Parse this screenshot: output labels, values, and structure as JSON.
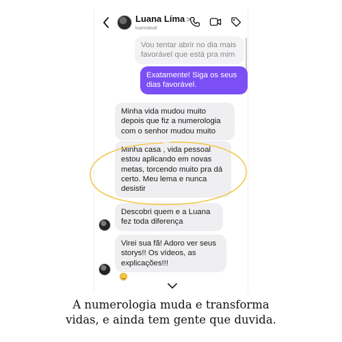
{
  "header": {
    "contact_name": "Luana Líma",
    "chevron": ">",
    "username": "luannawal",
    "icons": [
      "back-icon",
      "phone-icon",
      "video-icon",
      "tag-icon"
    ]
  },
  "messages": {
    "m1": "Vou tentar abrir no dia mais favorável que está pra mim",
    "m2": "Exatamente! Siga os seus dias favorável.",
    "m3": "Minha vida mudou muito depois que fiz a numerologia com o senhor mudou muito",
    "m4": "Minha casa , vida pessoal estou aplicando em novas metas, torcendo muito pra dá certo. Meu lema e nunca desistir",
    "m5": "Descobri quem e a Luana fez toda diferença",
    "m6": "Virei sua fã! Adoro ver seus storys!! Os vídeos, as explicações!!!"
  },
  "reaction_emoji": "smile-emoji",
  "caption": {
    "line1": "A numerologia muda e transforma",
    "line2": "vidas, e ainda tem gente que duvida."
  },
  "colors": {
    "outgoing_bubble": "#7b4ff5",
    "incoming_bubble": "#efeff1",
    "highlight": "#f2c84b"
  }
}
